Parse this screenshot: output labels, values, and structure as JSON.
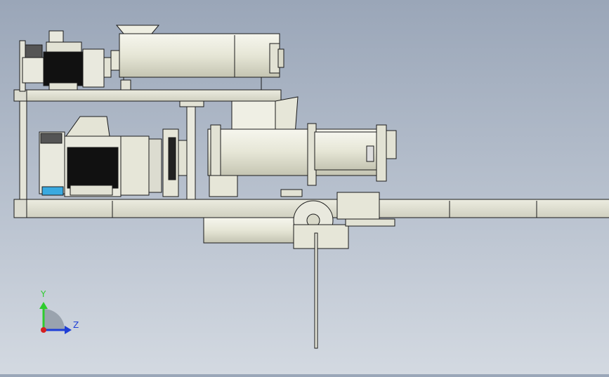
{
  "viewport": {
    "background": "#b4bdca"
  },
  "triad": {
    "y_label": "Y",
    "z_label": "Z",
    "y_color": "#2ecc2e",
    "z_color": "#1f3fd6",
    "x_color": "#d62020"
  },
  "model": {
    "icons": [
      "motor-icon",
      "screw-conveyor-icon",
      "frame-icon",
      "gearbox-icon",
      "flange-icon"
    ]
  }
}
